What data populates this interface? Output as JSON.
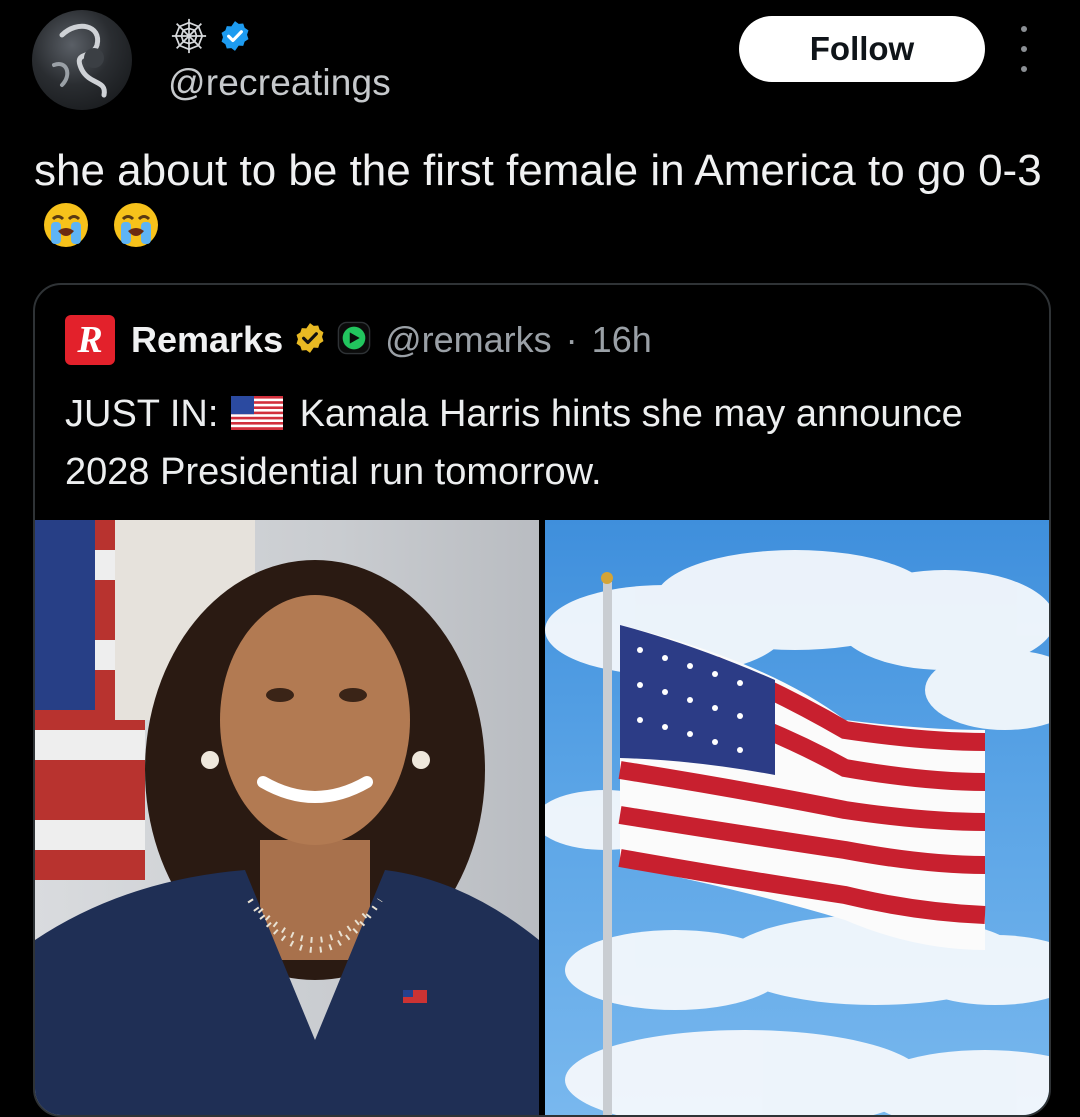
{
  "author": {
    "handle": "@recreatings",
    "icons": [
      "spider-web-icon",
      "verified-icon"
    ]
  },
  "actions": {
    "follow_label": "Follow",
    "more_icon": "more-icon"
  },
  "tweet": {
    "text": "she about to be the first female in America to go 0-3",
    "emojis": [
      "loudly-crying-face",
      "loudly-crying-face"
    ]
  },
  "quote": {
    "name": "Remarks",
    "handle": "@remarks",
    "separator": "·",
    "time": "16h",
    "text_prefix": "JUST IN:",
    "text_body": "Kamala Harris hints she may announce 2028 Presidential run tomorrow.",
    "media": [
      "portrait-photo",
      "american-flag-photo"
    ]
  },
  "colors": {
    "background": "#000000",
    "verified_blue": "#1d9bf0",
    "verified_gold": "#e8b923",
    "brand_red": "#e3212b"
  }
}
